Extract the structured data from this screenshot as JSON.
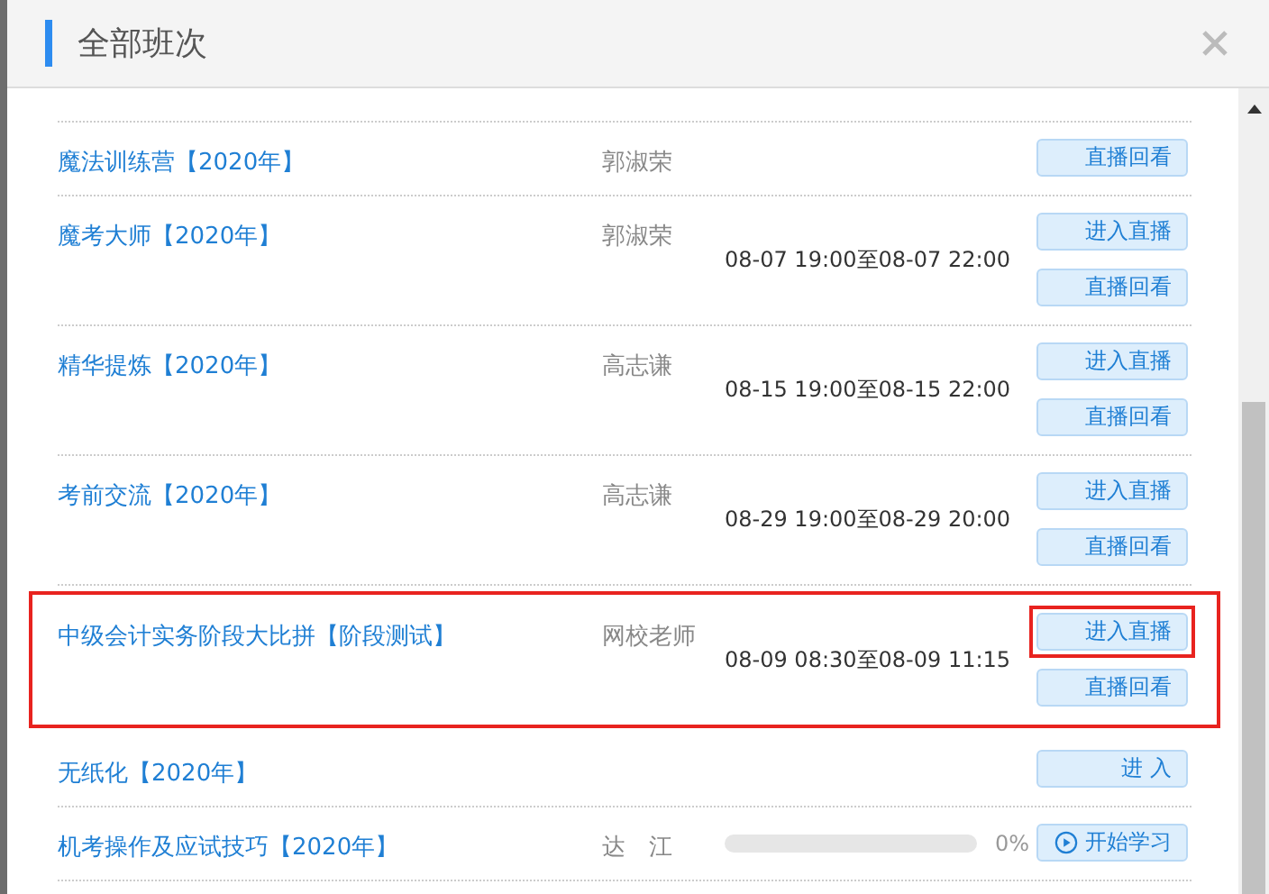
{
  "dialog": {
    "title": "全部班次"
  },
  "rows": [
    {
      "name": "魔法训练营【2020年】",
      "teacher": "郭淑荣",
      "highlighted": false,
      "buttons": [
        {
          "label": "直播回看",
          "kind": "plain",
          "highlighted": false
        }
      ]
    },
    {
      "name": "魔考大师【2020年】",
      "teacher": "郭淑荣",
      "time": "08-07 19:00至08-07 22:00",
      "highlighted": false,
      "buttons": [
        {
          "label": "进入直播",
          "kind": "plain",
          "highlighted": false
        },
        {
          "label": "直播回看",
          "kind": "plain",
          "highlighted": false
        }
      ]
    },
    {
      "name": "精华提炼【2020年】",
      "teacher": "高志谦",
      "time": "08-15 19:00至08-15 22:00",
      "highlighted": false,
      "buttons": [
        {
          "label": "进入直播",
          "kind": "plain",
          "highlighted": false
        },
        {
          "label": "直播回看",
          "kind": "plain",
          "highlighted": false
        }
      ]
    },
    {
      "name": "考前交流【2020年】",
      "teacher": "高志谦",
      "time": "08-29 19:00至08-29 20:00",
      "highlighted": false,
      "buttons": [
        {
          "label": "进入直播",
          "kind": "plain",
          "highlighted": false
        },
        {
          "label": "直播回看",
          "kind": "plain",
          "highlighted": false
        }
      ]
    },
    {
      "name": "中级会计实务阶段大比拼【阶段测试】",
      "teacher": "网校老师",
      "time": "08-09 08:30至08-09 11:15",
      "highlighted": true,
      "buttons": [
        {
          "label": "进入直播",
          "kind": "plain",
          "highlighted": true
        },
        {
          "label": "直播回看",
          "kind": "plain",
          "highlighted": false
        }
      ]
    },
    {
      "name": "无纸化【2020年】",
      "highlighted": false,
      "buttons": [
        {
          "label": "进 入",
          "kind": "plain",
          "highlighted": false
        }
      ]
    },
    {
      "name": "机考操作及应试技巧【2020年】",
      "teacher": "达　江",
      "progress": {
        "level": 0,
        "reading": "0%"
      },
      "highlighted": false,
      "buttons": [
        {
          "label": "开始学习",
          "kind": "play",
          "highlighted": false
        }
      ]
    }
  ]
}
